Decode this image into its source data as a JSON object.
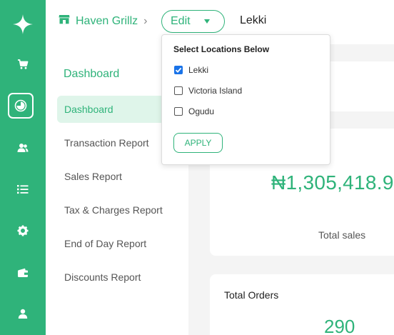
{
  "rail": {
    "icons": [
      "sparkle-logo-icon",
      "cart-icon",
      "pie-chart-icon",
      "users-icon",
      "list-icon",
      "gear-icon",
      "wallet-icon",
      "user-icon"
    ],
    "active": "pie-chart-icon",
    "color": "#2fb37a"
  },
  "header": {
    "store_name": "Haven Grillz",
    "edit_label": "Edit",
    "location": "Lekki"
  },
  "dropdown": {
    "title": "Select Locations Below",
    "options": [
      {
        "label": "Lekki",
        "checked": true
      },
      {
        "label": "Victoria Island",
        "checked": false
      },
      {
        "label": "Ogudu",
        "checked": false
      }
    ],
    "apply_label": "APPLY"
  },
  "sidebar": {
    "title": "Dashboard",
    "items": [
      {
        "label": "Dashboard",
        "active": true
      },
      {
        "label": "Transaction Report",
        "active": false
      },
      {
        "label": "Sales Report",
        "active": false
      },
      {
        "label": "Tax & Charges Report",
        "active": false
      },
      {
        "label": "End of Day Report",
        "active": false
      },
      {
        "label": "Discounts Report",
        "active": false
      }
    ]
  },
  "cards": {
    "total_sales": {
      "value": "₦1,305,418.9",
      "label": "Total sales"
    },
    "total_orders": {
      "title": "Total Orders",
      "value": "290"
    }
  },
  "colors": {
    "accent": "#2fb37a",
    "active_bg": "#dff5ea",
    "checkbox": "#1a73e8"
  }
}
